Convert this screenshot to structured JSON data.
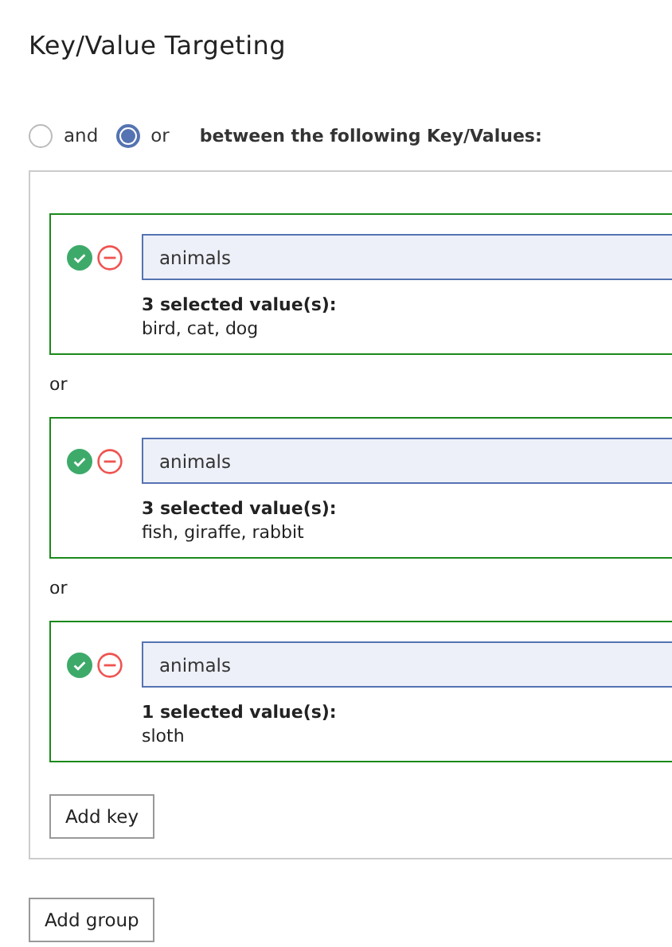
{
  "title": "Key/Value Targeting",
  "logic": {
    "options": [
      {
        "label": "and",
        "selected": false
      },
      {
        "label": "or",
        "selected": true
      }
    ],
    "description": "between the following Key/Values:"
  },
  "group": {
    "keys": [
      {
        "key": "animals",
        "summary": "3 selected value(s):",
        "values": "bird, cat, dog"
      },
      {
        "separator": "or",
        "key": "animals",
        "summary": "3 selected value(s):",
        "values": "fish, giraffe, rabbit"
      },
      {
        "separator": "or",
        "key": "animals",
        "summary": "1 selected value(s):",
        "values": "sloth"
      }
    ],
    "add_button": "Add key"
  },
  "add_group_button": "Add group"
}
